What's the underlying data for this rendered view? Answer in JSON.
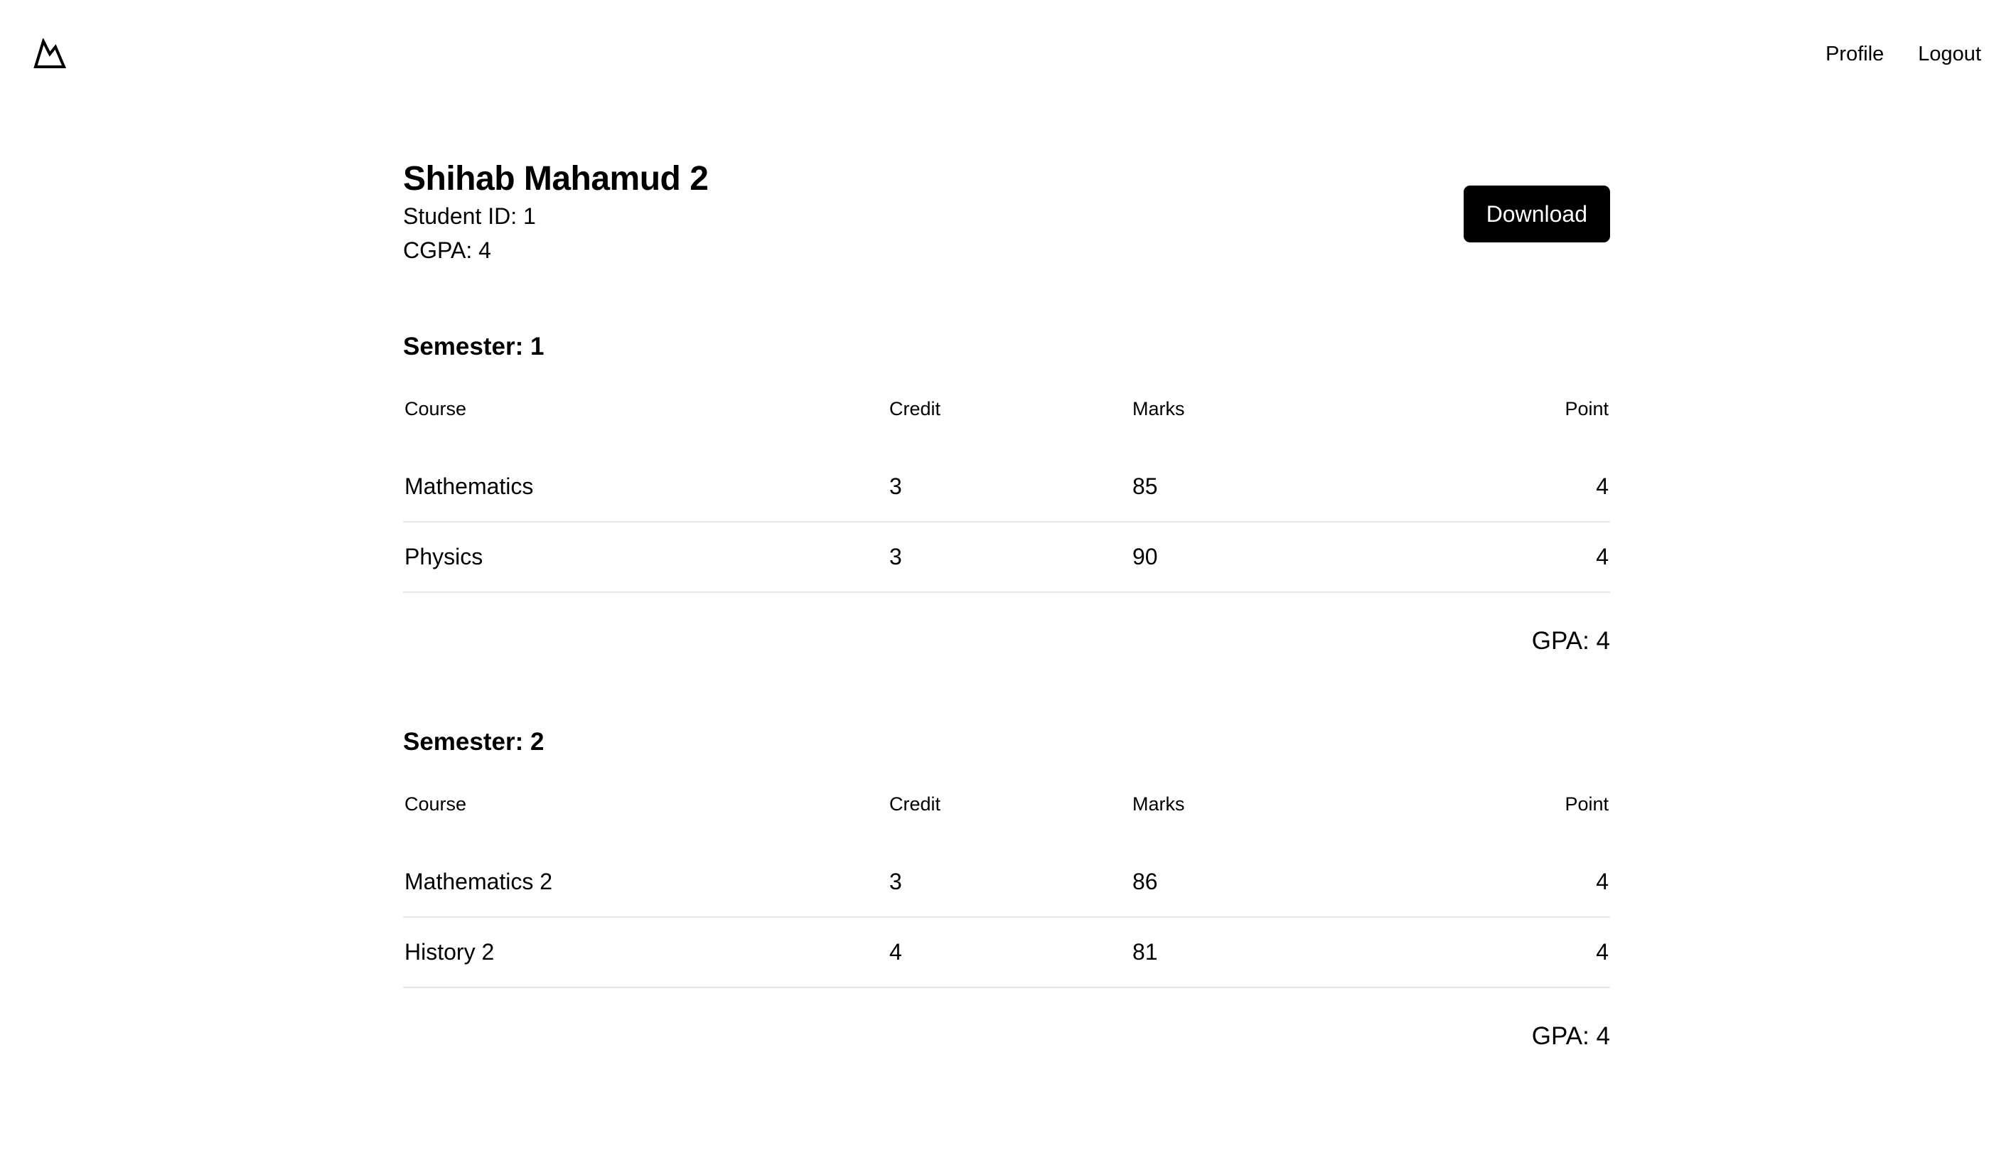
{
  "nav": {
    "logo_icon": "mountain-icon",
    "links": [
      "Profile",
      "Logout"
    ]
  },
  "student": {
    "name": "Shihab Mahamud 2",
    "id_text": "Student ID: 1",
    "cgpa_text": "CGPA: 4",
    "download_label": "Download"
  },
  "semesters": [
    {
      "title": "Semester: 1",
      "headers": [
        "Course",
        "Credit",
        "Marks",
        "Point"
      ],
      "rows": [
        [
          "Mathematics",
          "3",
          "85",
          "4"
        ],
        [
          "Physics",
          "3",
          "90",
          "4"
        ]
      ],
      "gpa_text": "GPA: 4"
    },
    {
      "title": "Semester: 2",
      "headers": [
        "Course",
        "Credit",
        "Marks",
        "Point"
      ],
      "rows": [
        [
          "Mathematics 2",
          "3",
          "86",
          "4"
        ],
        [
          "History 2",
          "4",
          "81",
          "4"
        ]
      ],
      "gpa_text": "GPA: 4"
    }
  ]
}
